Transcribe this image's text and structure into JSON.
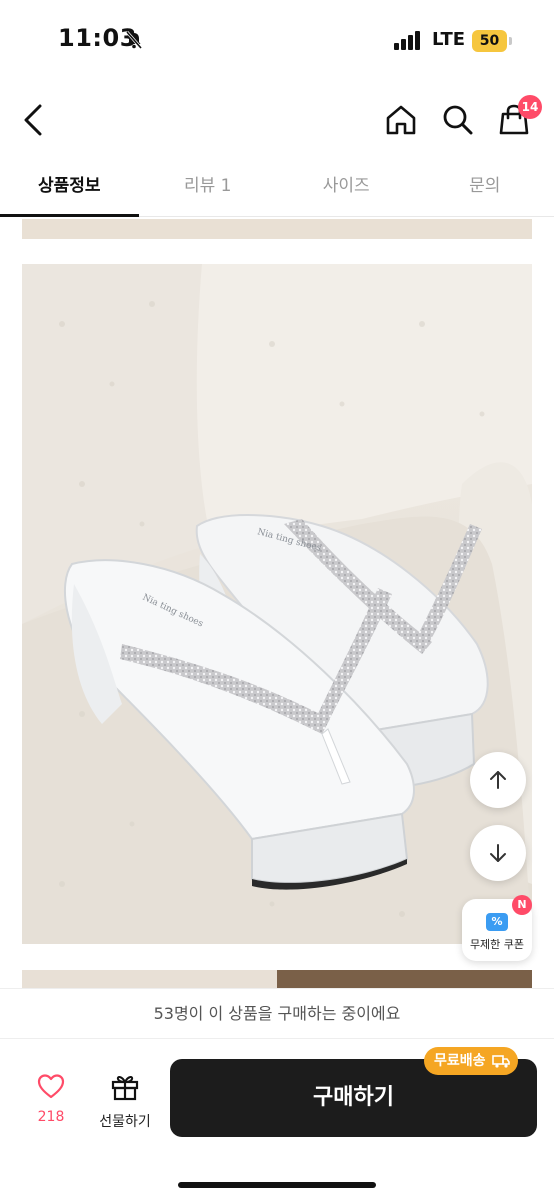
{
  "status_bar": {
    "time": "11:03",
    "network": "LTE",
    "battery": "50",
    "battery_color": "#f6c63e"
  },
  "nav": {
    "back_icon": "chevron-left-icon",
    "home_icon": "home-icon",
    "search_icon": "search-icon",
    "cart_icon": "shopping-bag-icon",
    "cart_count": "14"
  },
  "tabs": [
    {
      "label": "상품정보",
      "active": true
    },
    {
      "label": "리뷰 1",
      "active": false
    },
    {
      "label": "사이즈",
      "active": false
    },
    {
      "label": "문의",
      "active": false
    }
  ],
  "product": {
    "image_icon": "product-photo-white-platform-flip-flops"
  },
  "floating": {
    "scroll_up_icon": "arrow-up-icon",
    "scroll_down_icon": "arrow-down-icon",
    "coupon_label": "무제한 쿠폰",
    "coupon_badge": "N",
    "coupon_icon_text": "%"
  },
  "bottom": {
    "buying_now": "53명이 이 상품을 구매하는 중이에요",
    "like_count": "218",
    "gift_label": "선물하기",
    "buy_label": "구매하기",
    "free_shipping": "무료배송",
    "accent_color": "#ff4b68",
    "shipping_color": "#f5a623"
  }
}
